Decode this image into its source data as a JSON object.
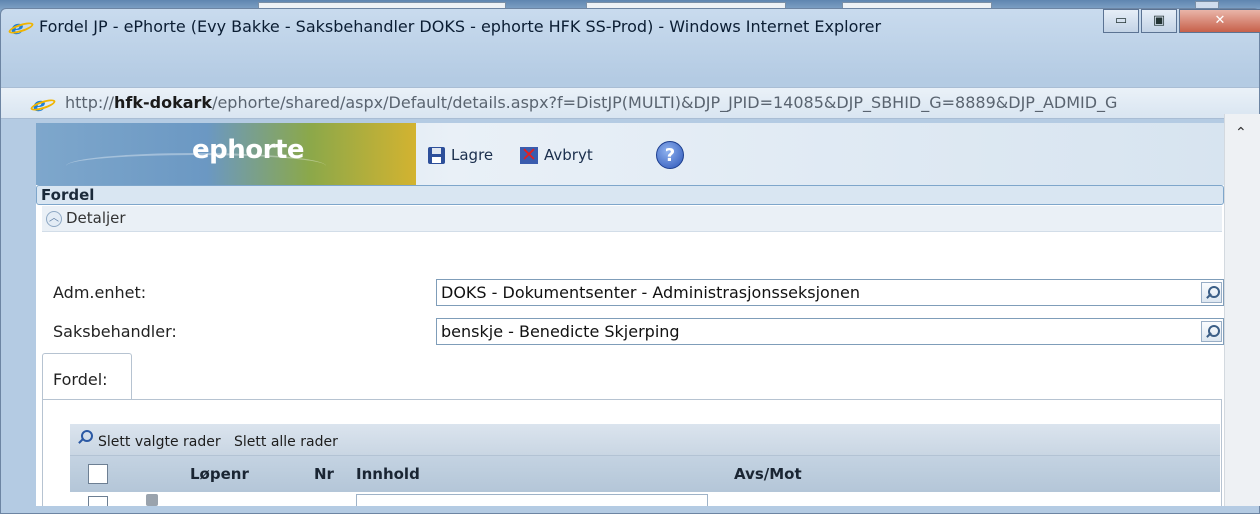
{
  "window": {
    "title": "Fordel JP - ePhorte (Evy Bakke - Saksbehandler DOKS - ephorte HFK SS-Prod) - Windows Internet Explorer",
    "minimize_glyph": "▭",
    "maximize_glyph": "▣",
    "close_glyph": "✕"
  },
  "address": {
    "prefix": "http://",
    "host": "hfk-dokark",
    "path": "/ephorte/shared/aspx/Default/details.aspx?f=DistJP(MULTI)&DJP_JPID=14085&DJP_SBHID_G=8889&DJP_ADMID_G"
  },
  "app": {
    "logo": "ephorte",
    "toolbar": {
      "save_label": "Lagre",
      "cancel_label": "Avbryt",
      "help_glyph": "?"
    }
  },
  "section": {
    "title": "Fordel",
    "details_label": "Detaljer"
  },
  "form": {
    "adm_enhet": {
      "label": "Adm.enhet:",
      "value": "DOKS - Dokumentsenter - Administrasjonsseksjonen"
    },
    "saksbehandler": {
      "label": "Saksbehandler:",
      "value": "benskje - Benedicte Skjerping"
    }
  },
  "tabs": [
    {
      "label": "Fordel:"
    }
  ],
  "grid": {
    "toolbar": {
      "delete_selected": "Slett valgte rader",
      "delete_all": "Slett alle rader"
    },
    "columns": [
      "Løpenr",
      "Nr",
      "Innhold",
      "Avs/Mot"
    ]
  }
}
